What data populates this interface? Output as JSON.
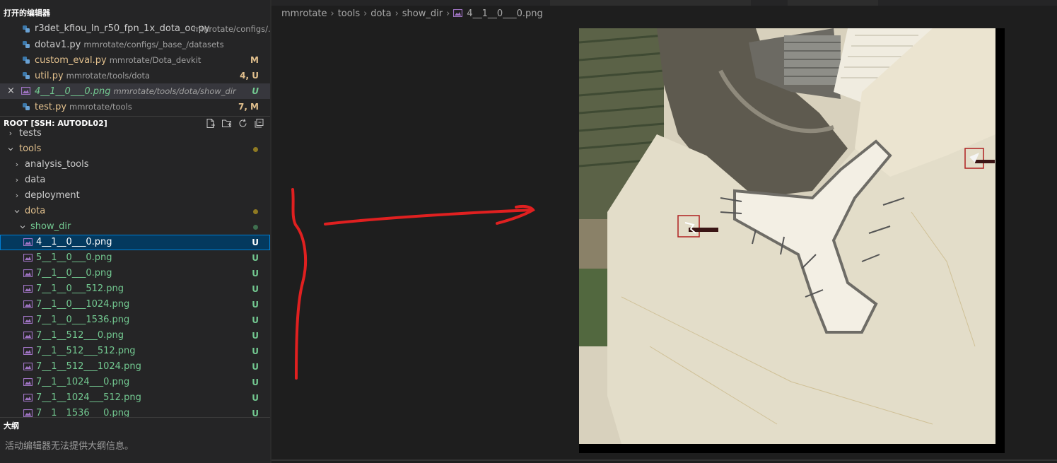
{
  "open_editors": {
    "title": "打开的编辑器",
    "items": [
      {
        "name": "r3det_kfiou_ln_r50_fpn_1x_dota_oc.py",
        "desc": "mmrotate/configs/...",
        "status": ""
      },
      {
        "name": "dotav1.py",
        "desc": "mmrotate/configs/_base_/datasets",
        "status": ""
      },
      {
        "name": "custom_eval.py",
        "desc": "mmrotate/Dota_devkit",
        "status": "M"
      },
      {
        "name": "util.py",
        "desc": "mmrotate/tools/dota",
        "status": "4, U"
      },
      {
        "name": "4__1__0___0.png",
        "desc": "mmrotate/tools/dota/show_dir",
        "status": "U",
        "close": "×"
      },
      {
        "name": "test.py",
        "desc": "mmrotate/tools",
        "status": "7, M"
      }
    ]
  },
  "explorer": {
    "root_title": "ROOT [SSH: AUTODL02]",
    "tree": [
      {
        "label": "tests"
      },
      {
        "label": "tools"
      },
      {
        "label": "analysis_tools"
      },
      {
        "label": "data"
      },
      {
        "label": "deployment"
      },
      {
        "label": "dota"
      },
      {
        "label": "show_dir"
      },
      {
        "label": "4__1__0___0.png",
        "status": "U"
      },
      {
        "label": "5__1__0___0.png",
        "status": "U"
      },
      {
        "label": "7__1__0___0.png",
        "status": "U"
      },
      {
        "label": "7__1__0___512.png",
        "status": "U"
      },
      {
        "label": "7__1__0___1024.png",
        "status": "U"
      },
      {
        "label": "7__1__0___1536.png",
        "status": "U"
      },
      {
        "label": "7__1__512___0.png",
        "status": "U"
      },
      {
        "label": "7__1__512___512.png",
        "status": "U"
      },
      {
        "label": "7__1__512___1024.png",
        "status": "U"
      },
      {
        "label": "7__1__1024___0.png",
        "status": "U"
      },
      {
        "label": "7__1__1024___512.png",
        "status": "U"
      },
      {
        "label": "7__1__1536___0.png",
        "status": "U"
      }
    ]
  },
  "outline": {
    "title": "大纲",
    "message": "活动编辑器无法提供大纲信息。"
  },
  "breadcrumb": {
    "items": [
      "mmrotate",
      "tools",
      "dota",
      "show_dir",
      "4__1__0___0.png"
    ],
    "separator": "›"
  },
  "colors": {
    "modified": "#e2c08d",
    "untracked": "#73c991",
    "selection": "#04395e",
    "annotation": "#e02020"
  }
}
